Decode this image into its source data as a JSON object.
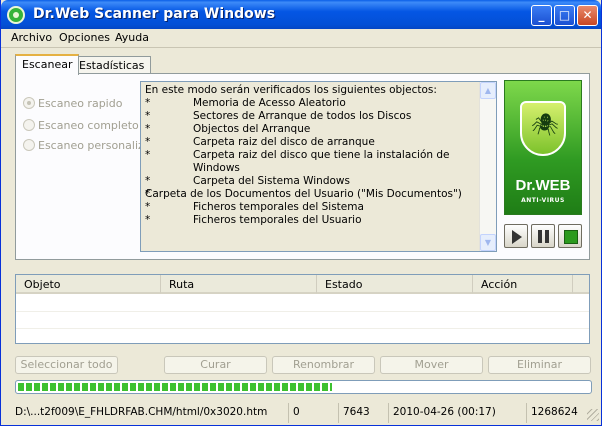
{
  "window": {
    "title": "Dr.Web Scanner para Windows",
    "controls": {
      "minimize": "_",
      "maximize": "□",
      "close": "✕"
    }
  },
  "menu": [
    "Archivo",
    "Opciones",
    "Ayuda"
  ],
  "tabs": [
    {
      "label": "Escanear",
      "active": true
    },
    {
      "label": "Estadísticas",
      "active": false
    }
  ],
  "scan_modes": [
    {
      "label": "Escaneo rapido",
      "checked": true,
      "enabled": false
    },
    {
      "label": "Escaneo completo",
      "checked": false,
      "enabled": false
    },
    {
      "label": "Escaneo personalizado",
      "checked": false,
      "enabled": false
    }
  ],
  "info": {
    "intro": "En este modo serán verificados los siguientes objectos:",
    "bullet_symbol": "*",
    "items": [
      "Memoria de Acesso Aleatorio",
      "Sectores de Arranque de todos los Discos",
      "Objectos del Arranque",
      "Carpeta raiz del disco de arranque",
      "Carpeta raiz del disco que tiene la instalación de Windows",
      "Carpeta del Sistema Windows",
      "Carpeta de los Documentos del Usuario (\"Mis Documentos\")",
      "Ficheros temporales del Sistema",
      "Ficheros temporales del Usuario"
    ]
  },
  "logo": {
    "name": "Dr.WEB",
    "subtitle": "ANTI-VIRUS"
  },
  "results_table": {
    "columns": [
      "Objeto",
      "Ruta",
      "Estado",
      "Acción"
    ],
    "rows": []
  },
  "actions": [
    "Seleccionar todo",
    "Curar",
    "Renombrar",
    "Mover",
    "Eliminar"
  ],
  "progress": {
    "fraction": 0.55,
    "color": "#3dc130"
  },
  "status": {
    "path": "D:\\...t2f009\\E_FHLDRFAB.CHM/html/0x3020.htm",
    "infected": "0",
    "scanned": "7643",
    "datetime": "2010-04-26 (00:17)",
    "size": "1268624"
  },
  "colors": {
    "title_blue": "#0456e4",
    "window_bg": "#ece9d8"
  }
}
